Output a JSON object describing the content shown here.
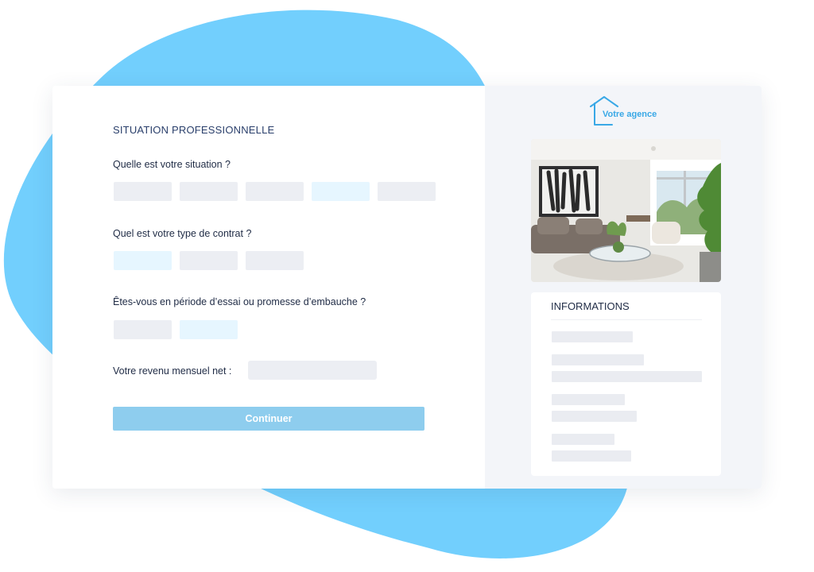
{
  "form": {
    "section_title": "SITUATION PROFESSIONNELLE",
    "q1": "Quelle est votre situation ?",
    "q2": "Quel est votre type de contrat ?",
    "q3": "Êtes-vous en période d’essai ou promesse d’embauche ?",
    "q4": "Votre revenu mensuel net :",
    "continue_label": "Continuer"
  },
  "sidebar": {
    "logo_text": "Votre agence",
    "info_title": "INFORMATIONS"
  },
  "colors": {
    "blob": "#72cffd",
    "accent": "#39a8e6",
    "button": "#8ecdee",
    "option_selected": "#e6f6ff",
    "option": "#eceef3"
  },
  "icons": [
    "house-icon"
  ]
}
